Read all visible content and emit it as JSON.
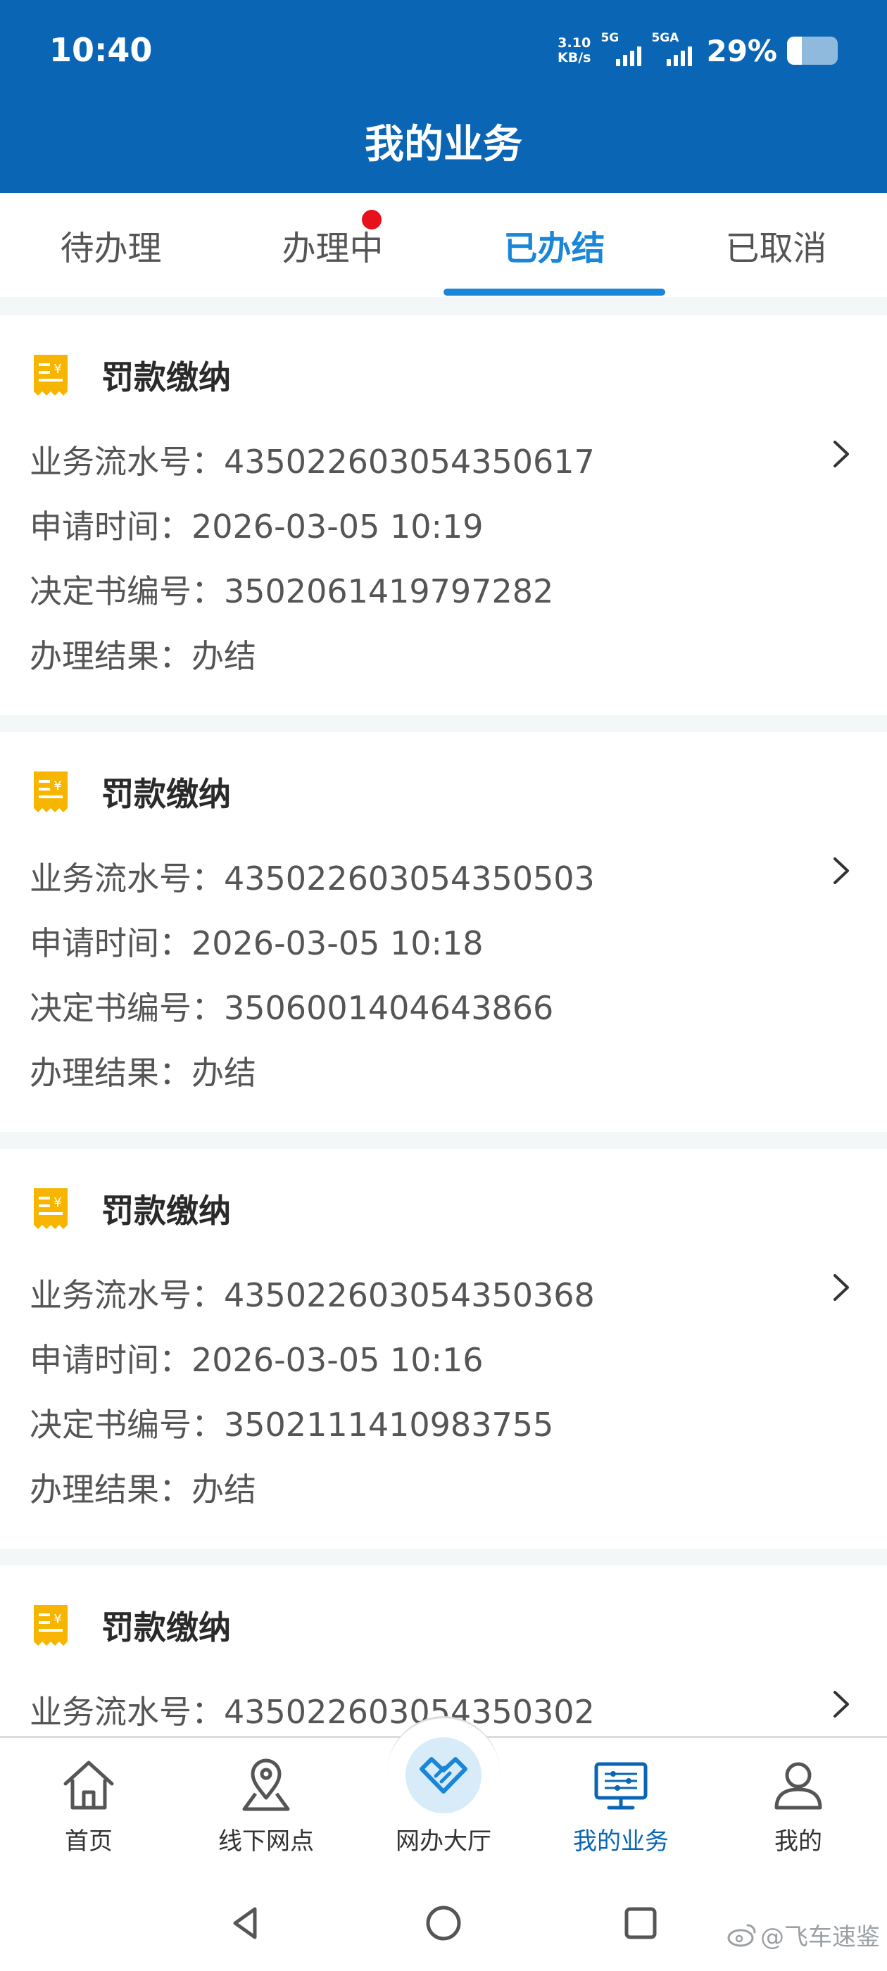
{
  "status_bar": {
    "time": "10:40",
    "net_speed_value": "3.10",
    "net_speed_unit": "KB/s",
    "signal1_label": "5G",
    "signal2_label": "5GA",
    "battery_text": "29%",
    "battery_level": 0.29
  },
  "header": {
    "title": "我的业务"
  },
  "tabs": [
    {
      "label": "待办理",
      "active": false
    },
    {
      "label": "办理中",
      "active": false,
      "has_badge": true
    },
    {
      "label": "已办结",
      "active": true
    },
    {
      "label": "已取消",
      "active": false
    }
  ],
  "records": [
    {
      "title": "罚款缴纳",
      "serial_label": "业务流水号：",
      "serial": "435022603054350617",
      "time_label": "申请时间：",
      "time": "2026-03-05 10:19",
      "decision_label": "决定书编号：",
      "decision": "3502061419797282",
      "result_label": "办理结果：",
      "result": "办结"
    },
    {
      "title": "罚款缴纳",
      "serial_label": "业务流水号：",
      "serial": "435022603054350503",
      "time_label": "申请时间：",
      "time": "2026-03-05 10:18",
      "decision_label": "决定书编号：",
      "decision": "3506001404643866",
      "result_label": "办理结果：",
      "result": "办结"
    },
    {
      "title": "罚款缴纳",
      "serial_label": "业务流水号：",
      "serial": "435022603054350368",
      "time_label": "申请时间：",
      "time": "2026-03-05 10:16",
      "decision_label": "决定书编号：",
      "decision": "3502111410983755",
      "result_label": "办理结果：",
      "result": "办结"
    },
    {
      "title": "罚款缴纳",
      "serial_label": "业务流水号：",
      "serial": "435022603054350302"
    }
  ],
  "bottom_nav": [
    {
      "label": "首页",
      "icon": "home-icon"
    },
    {
      "label": "线下网点",
      "icon": "location-pin-icon"
    },
    {
      "label": "网办大厅",
      "icon": "handshake-icon"
    },
    {
      "label": "我的业务",
      "icon": "monitor-icon",
      "active": true
    },
    {
      "label": "我的",
      "icon": "user-icon"
    }
  ],
  "watermark": "@飞车速鉴",
  "colors": {
    "header_bg": "#0a66b4",
    "tab_active": "#1a86d9",
    "badge": "#e8101b",
    "receipt_icon": "#f7b500"
  }
}
